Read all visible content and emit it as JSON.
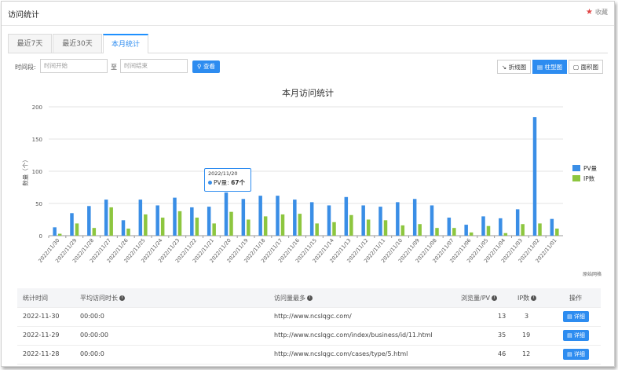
{
  "header": {
    "title": "访问统计",
    "favorite_label": "收藏"
  },
  "tabs": [
    {
      "label": "最近7天"
    },
    {
      "label": "最近30天"
    },
    {
      "label": "本月统计"
    }
  ],
  "filter": {
    "label": "时间段:",
    "start_placeholder": "时间开始",
    "separator": "至",
    "end_placeholder": "时间结束",
    "search_label": "查看"
  },
  "chart_types": [
    {
      "label": "折线图"
    },
    {
      "label": "柱型图"
    },
    {
      "label": "面积图"
    }
  ],
  "chart_source": "原始网格",
  "tooltip": {
    "date": "2022/11/20",
    "series": "PV量",
    "value_text": "67个"
  },
  "chart_data": {
    "type": "bar",
    "title": "本月访问统计",
    "ylabel": "数量（个）",
    "ylim": [
      0,
      200
    ],
    "yticks": [
      0,
      50,
      100,
      150,
      200
    ],
    "legend_position": "right",
    "categories": [
      "2022/11/30",
      "2022/11/29",
      "2022/11/28",
      "2022/11/27",
      "2022/11/26",
      "2022/11/25",
      "2022/11/24",
      "2022/11/23",
      "2022/11/22",
      "2022/11/21",
      "2022/11/20",
      "2022/11/19",
      "2022/11/18",
      "2022/11/17",
      "2022/11/16",
      "2022/11/15",
      "2022/11/14",
      "2022/11/13",
      "2022/11/12",
      "2022/11/11",
      "2022/11/10",
      "2022/11/09",
      "2022/11/08",
      "2022/11/07",
      "2022/11/06",
      "2022/11/05",
      "2022/11/04",
      "2022/11/03",
      "2022/11/02",
      "2022/11/01"
    ],
    "series": [
      {
        "name": "PV量",
        "color": "#3a8ee6",
        "values": [
          13,
          35,
          46,
          56,
          24,
          56,
          47,
          59,
          44,
          45,
          67,
          57,
          62,
          62,
          56,
          52,
          47,
          60,
          47,
          45,
          52,
          57,
          47,
          28,
          17,
          30,
          27,
          41,
          184,
          26
        ]
      },
      {
        "name": "IP数",
        "color": "#8dc63f",
        "values": [
          3,
          19,
          12,
          44,
          11,
          33,
          28,
          38,
          28,
          19,
          37,
          25,
          30,
          33,
          34,
          19,
          21,
          32,
          25,
          24,
          16,
          18,
          12,
          12,
          5,
          15,
          4,
          18,
          19,
          11
        ]
      }
    ]
  },
  "table": {
    "headers": [
      "统计时间",
      "平均访问时长",
      "访问量最多",
      "浏览量/PV",
      "IP数",
      "操作"
    ],
    "rows": [
      [
        "2022-11-30",
        "00:00:0",
        "http://www.ncslqgc.com/",
        "13",
        "3"
      ],
      [
        "2022-11-29",
        "00:00:00",
        "http://www.ncslqgc.com/index/business/id/11.html",
        "35",
        "19"
      ],
      [
        "2022-11-28",
        "00:00:0",
        "http://www.ncslqgc.com/cases/type/5.html",
        "46",
        "12"
      ]
    ],
    "detail_label": "详细"
  }
}
